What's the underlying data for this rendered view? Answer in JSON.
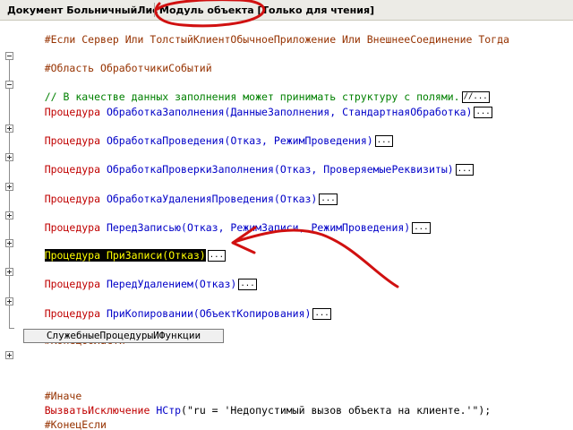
{
  "tabs": [
    {
      "label": "Документ БольничныйЛист"
    },
    {
      "label": "Модуль объекта [Только для чтения]"
    }
  ],
  "code": {
    "directive_if": "#Если Сервер Или ТолстыйКлиентОбычноеПриложение Или ВнешнееСоединение Тогда",
    "region_start": "#Область ОбработчикиСобытий",
    "comment": "// В качестве данных заполнения может принимать структуру с полями.",
    "comment_collapsed": "//...",
    "keyword_proc": "Процедура",
    "procs": [
      {
        "name": "ОбработкаЗаполнения",
        "params": "(ДанныеЗаполнения, СтандартнаяОбработка)"
      },
      {
        "name": "ОбработкаПроведения",
        "params": "(Отказ, РежимПроведения)"
      },
      {
        "name": "ОбработкаПроверкиЗаполнения",
        "params": "(Отказ, ПроверяемыеРеквизиты)"
      },
      {
        "name": "ОбработкаУдаленияПроведения",
        "params": "(Отказ)"
      },
      {
        "name": "ПередЗаписью",
        "params": "(Отказ, РежимЗаписи, РежимПроведения)"
      },
      {
        "name": "ПриЗаписи",
        "params": "(Отказ)"
      },
      {
        "name": "ПередУдалением",
        "params": "(Отказ)"
      },
      {
        "name": "ПриКопировании",
        "params": "(ОбъектКопирования)"
      }
    ],
    "ellipsis": "...",
    "region_end": "#КонецОбласти",
    "collapsed_region": "СлужебныеПроцедурыИФункции",
    "directive_else": "#Иначе",
    "raise_kw": "ВызватьИсключение",
    "raise_fn": "НСтр",
    "raise_str": "(\"ru = 'Недопустимый вызов объекта на клиенте.'\");",
    "directive_endif": "#КонецЕсли"
  },
  "colors": {
    "keyword": "#c00000",
    "identifier": "#0000c8",
    "comment": "#008000",
    "annotation": "#d01010",
    "highlight_bg": "#000000",
    "highlight_fg": "#ffff00"
  }
}
